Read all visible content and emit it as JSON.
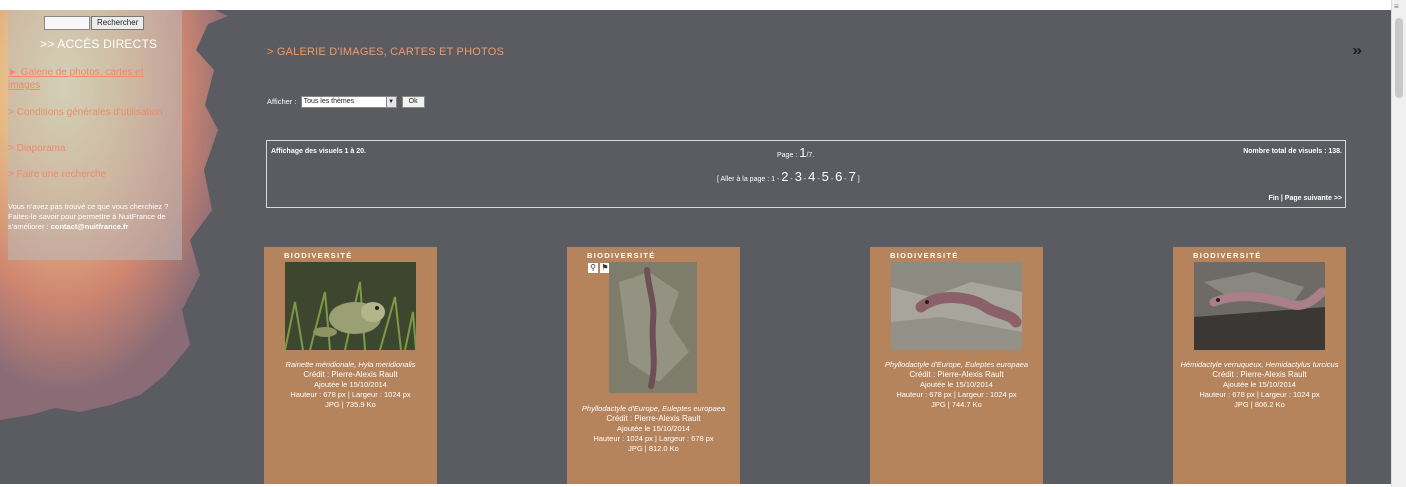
{
  "search": {
    "button_label": "Rechercher"
  },
  "sidebar": {
    "heading": ">> ACCÈS DIRECTS",
    "links": [
      "► Galerie de photos, cartes et images",
      "> Conditions générales d'utilisation",
      "> Diaporama",
      "> Faire une recherche"
    ],
    "note": "Vous n'avez pas trouvé ce que vous cherchiez ? Faites-le savoir pour permettre à NuitFrance de s'améliorer : ",
    "note_email": "contact@nuitfrance.fr"
  },
  "page": {
    "title": "> GALERIE D'IMAGES, CARTES ET PHOTOS",
    "chevron": "»"
  },
  "filter": {
    "label": "Afficher :",
    "selected": "Tous les thèmes",
    "ok_label": "Ok"
  },
  "pagination": {
    "showing": "Affichage des visuels 1 à 20.",
    "page_label": "Page :",
    "page_current": "1",
    "page_total": "/7.",
    "total": "Nombre total de visuels : 138.",
    "goto_label": "[ Aller à la page : ",
    "goto_first": "1",
    "pages": [
      "2",
      "3",
      "4",
      "5",
      "6",
      "7"
    ],
    "goto_end": " ]",
    "nav": "Fin | Page suivante >>"
  },
  "cards": [
    {
      "category": "BIODIVERSITÉ",
      "title": "Rainette méridionale, Hyla meridionalis",
      "credit": "Crédit : Pierre-Alexis Rault",
      "added": "Ajoutée le 15/10/2014",
      "dims": "Hauteur : 678 px | Largeur : 1024 px",
      "file": "JPG | 735.9 Ko"
    },
    {
      "category": "BIODIVERSITÉ",
      "title": "Phyllodactyle d'Europe, Euleptes europaea",
      "credit": "Crédit : Pierre-Alexis Rault",
      "added": "Ajoutée le 15/10/2014",
      "dims": "Hauteur : 1024 px | Largeur : 678 px",
      "file": "JPG | 812.0 Ko"
    },
    {
      "category": "BIODIVERSITÉ",
      "title": "Phyllodactyle d'Europe, Euleptes europaea",
      "credit": "Crédit : Pierre-Alexis Rault",
      "added": "Ajoutée le 15/10/2014",
      "dims": "Hauteur : 678 px | Largeur : 1024 px",
      "file": "JPG | 744.7 Ko"
    },
    {
      "category": "BIODIVERSITÉ",
      "title": "Hémidactyle verruqueux, Hemidactylus turcicus",
      "credit": "Crédit : Pierre-Alexis Rault",
      "added": "Ajoutée le 15/10/2014",
      "dims": "Hauteur : 678 px | Largeur : 1024 px",
      "file": "JPG | 806.2 Ko"
    }
  ],
  "icons": {
    "zoom": "magnifier-icon",
    "download": "download-icon"
  },
  "colors": {
    "background": "#5b5b62",
    "accent": "#ee9b6a",
    "card": "#b5845c"
  }
}
